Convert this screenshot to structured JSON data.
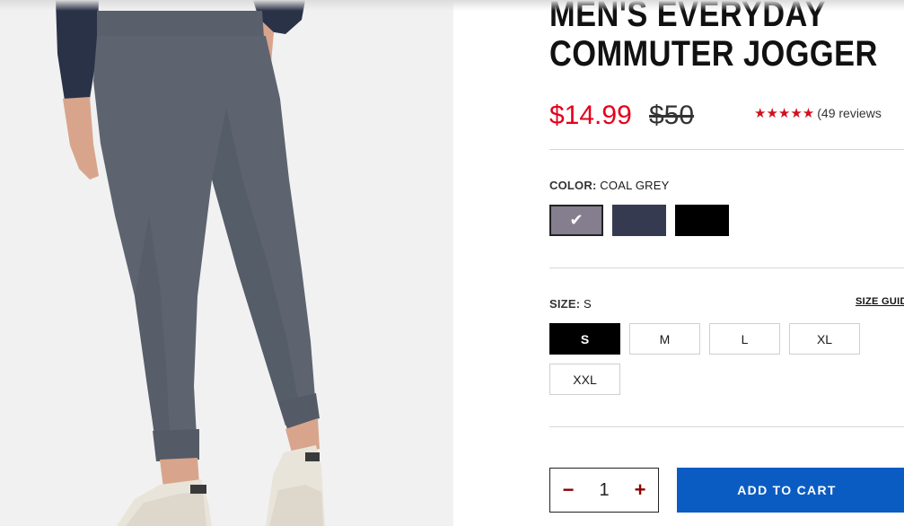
{
  "product": {
    "title_line1": "MEN'S EVERYDAY",
    "title_line2": "COMMUTER JOGGER",
    "sale_price": "$14.99",
    "original_price": "$50",
    "stars": "★★★★★",
    "reviews": "(49 reviews"
  },
  "color": {
    "label": "COLOR:",
    "selected": "COAL GREY",
    "swatches": [
      {
        "name": "Coal Grey",
        "hex": "#857e8e",
        "selected": true
      },
      {
        "name": "Navy",
        "hex": "#363a51",
        "selected": false
      },
      {
        "name": "Black",
        "hex": "#000000",
        "selected": false
      }
    ],
    "check_glyph": "✔"
  },
  "size": {
    "label": "SIZE:",
    "selected": "S",
    "guide": "SIZE GUID",
    "options": [
      "S",
      "M",
      "L",
      "XL",
      "XXL"
    ]
  },
  "cart": {
    "minus": "−",
    "quantity": "1",
    "plus": "+",
    "add_label": "ADD TO CART"
  },
  "colors": {
    "sale": "#e4001b",
    "stars": "#d0101e",
    "cta": "#0b5cc2",
    "pants": "#5d6470"
  },
  "image": {
    "alt": "product-photo-jogger"
  }
}
